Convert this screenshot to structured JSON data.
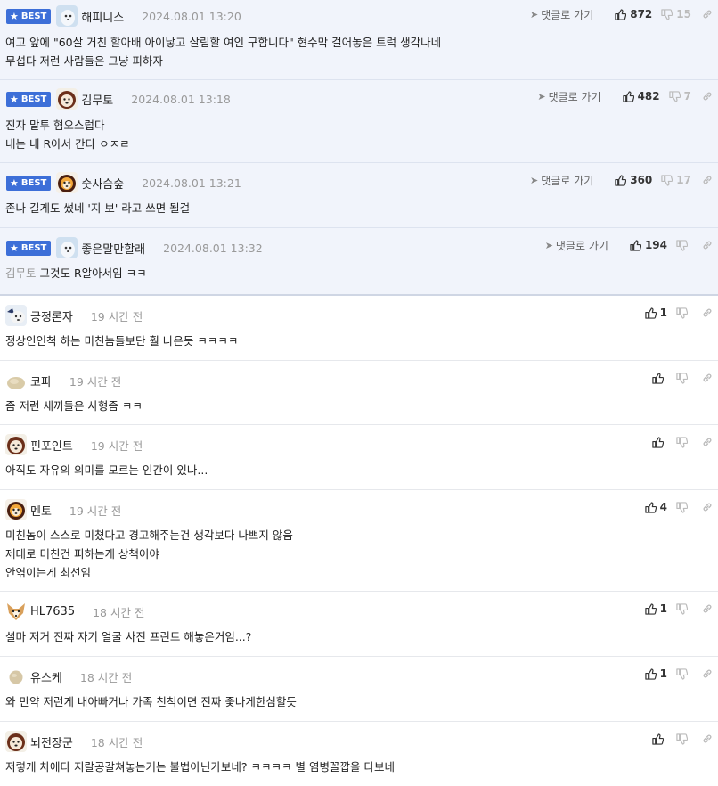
{
  "best_badge": "BEST",
  "reply_label": "댓글로 가기",
  "best_comments": [
    {
      "nick": "해피니스",
      "time": "2024.08.01 13:20",
      "up": "872",
      "down": "15",
      "lines": [
        "여고 앞에 \"60살 거친 할아배 아이낳고 살림할 여인 구합니다\" 현수막 걸어놓은 트럭 생각나네",
        "무섭다 저런 사람들은 그냥 피하자"
      ],
      "mention": ""
    },
    {
      "nick": "김무토",
      "time": "2024.08.01 13:18",
      "up": "482",
      "down": "7",
      "lines": [
        "진자 말투 혐오스럽다",
        "내는 내 R아서 간다 ㅇㅈㄹ"
      ],
      "mention": ""
    },
    {
      "nick": "숫사슴숲",
      "time": "2024.08.01 13:21",
      "up": "360",
      "down": "17",
      "lines": [
        "존나 길게도 썼네 '지 보' 라고 쓰면 될걸"
      ],
      "mention": ""
    },
    {
      "nick": "좋은말만할래",
      "time": "2024.08.01 13:32",
      "up": "194",
      "down": "",
      "lines": [
        "그것도 R알아서임 ㅋㅋ"
      ],
      "mention": "김무토"
    }
  ],
  "comments": [
    {
      "nick": "긍정론자",
      "time": "19 시간 전",
      "up": "1",
      "lines": [
        "정상인인척 하는 미친놈들보단 훨 나은듯 ㅋㅋㅋㅋ"
      ]
    },
    {
      "nick": "코파",
      "time": "19 시간 전",
      "up": "",
      "lines": [
        "좀 저런 새끼들은 사형좀 ㅋㅋ"
      ]
    },
    {
      "nick": "핀포인트",
      "time": "19 시간 전",
      "up": "",
      "lines": [
        "아직도 자유의 의미를 모르는 인간이 있나..."
      ]
    },
    {
      "nick": "멘토",
      "time": "19 시간 전",
      "up": "4",
      "lines": [
        "미친놈이 스스로 미쳤다고 경고해주는건 생각보다 나쁘지 않음",
        "제대로 미친건 피하는게 상책이야",
        "안엮이는게 최선임"
      ]
    },
    {
      "nick": "HL7635",
      "time": "18 시간 전",
      "up": "1",
      "lines": [
        "설마 저거 진짜 자기 얼굴 사진 프린트 해놓은거임...?"
      ]
    },
    {
      "nick": "유스케",
      "time": "18 시간 전",
      "up": "1",
      "lines": [
        "와 만약 저런게 내아빠거나 가족 친척이면 진짜 좇나게한심할듯"
      ]
    },
    {
      "nick": "뇌전장군",
      "time": "18 시간 전",
      "up": "",
      "lines": [
        "저렇게 차에다 지랄공갈쳐놓는거는 불법아닌가보네? ㅋㅋㅋㅋ 별 염병꼴깝을 다보네"
      ]
    }
  ],
  "colors": {
    "best_bg": "#f1f4fb",
    "badge": "#3d6fd8",
    "muted": "#999999"
  }
}
